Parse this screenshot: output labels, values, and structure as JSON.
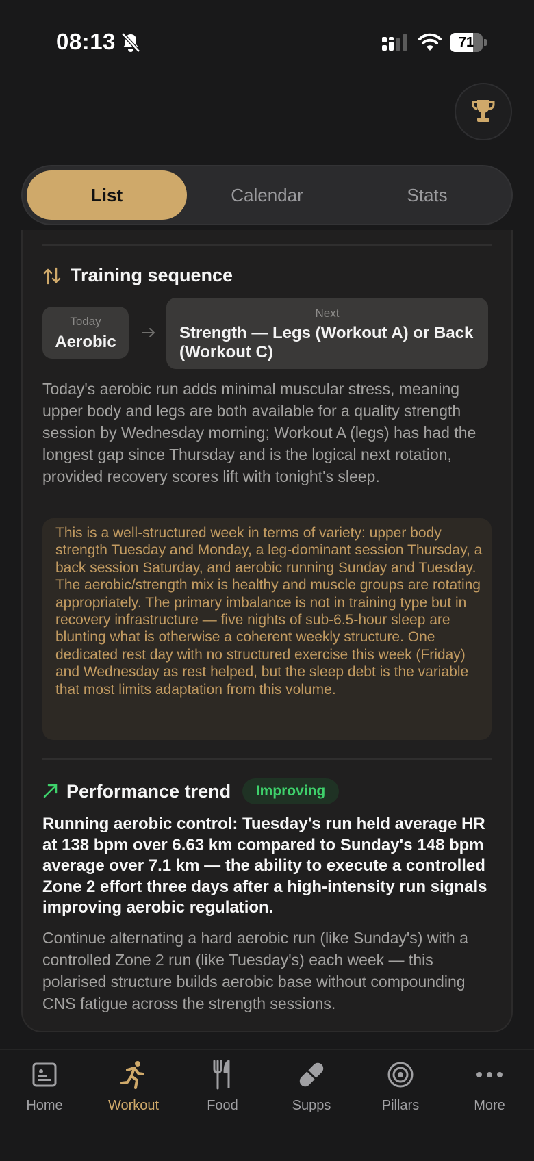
{
  "status_bar": {
    "time": "08:13",
    "battery": 71
  },
  "segmented": {
    "tabs": [
      "List",
      "Calendar",
      "Stats"
    ],
    "active": "List"
  },
  "training_sequence": {
    "title": "Training sequence",
    "today_label": "Today",
    "today_value": "Aerobic",
    "next_label": "Next",
    "next_value": "Strength — Legs (Workout A) or Back (Workout C)",
    "rationale": "Today's aerobic run adds minimal muscular stress, meaning upper body and legs are both available for a quality strength session by Wednesday morning; Workout A (legs) has had the longest gap since Thursday and is the logical next rotation, provided recovery scores lift with tonight's sleep.",
    "insight": "This is a well-structured week in terms of variety: upper body strength Tuesday and Monday, a leg-dominant session Thursday, a back session Saturday, and aerobic running Sunday and Tuesday. The aerobic/strength mix is healthy and muscle groups are rotating appropriately. The primary imbalance is not in training type but in recovery infrastructure — five nights of sub-6.5-hour sleep are blunting what is otherwise a coherent weekly structure. One dedicated rest day with no structured exercise this week (Friday) and Wednesday as rest helped, but the sleep debt is the variable that most limits adaptation from this volume."
  },
  "performance_trend": {
    "title": "Performance trend",
    "badge": "Improving",
    "headline": "Running aerobic control: Tuesday's run held average HR at 138 bpm over 6.63 km compared to Sunday's 148 bpm average over 7.1 km — the ability to execute a controlled Zone 2 effort three days after a high-intensity run signals improving aerobic regulation.",
    "advice": "Continue alternating a hard aerobic run (like Sunday's) with a controlled Zone 2 run (like Tuesday's) each week — this polarised structure builds aerobic base without compounding CNS fatigue across the strength sessions."
  },
  "tab_bar": {
    "items": [
      {
        "label": "Home",
        "icon": "home-icon"
      },
      {
        "label": "Workout",
        "icon": "running-icon"
      },
      {
        "label": "Food",
        "icon": "fork-knife-icon"
      },
      {
        "label": "Supps",
        "icon": "pill-icon"
      },
      {
        "label": "Pillars",
        "icon": "target-icon"
      },
      {
        "label": "More",
        "icon": "more-icon"
      }
    ],
    "active": "Workout"
  },
  "colors": {
    "accent": "#cfa96a",
    "insight_text": "#c29b61",
    "badge_green": "#3ed16b",
    "background": "#19191a"
  }
}
